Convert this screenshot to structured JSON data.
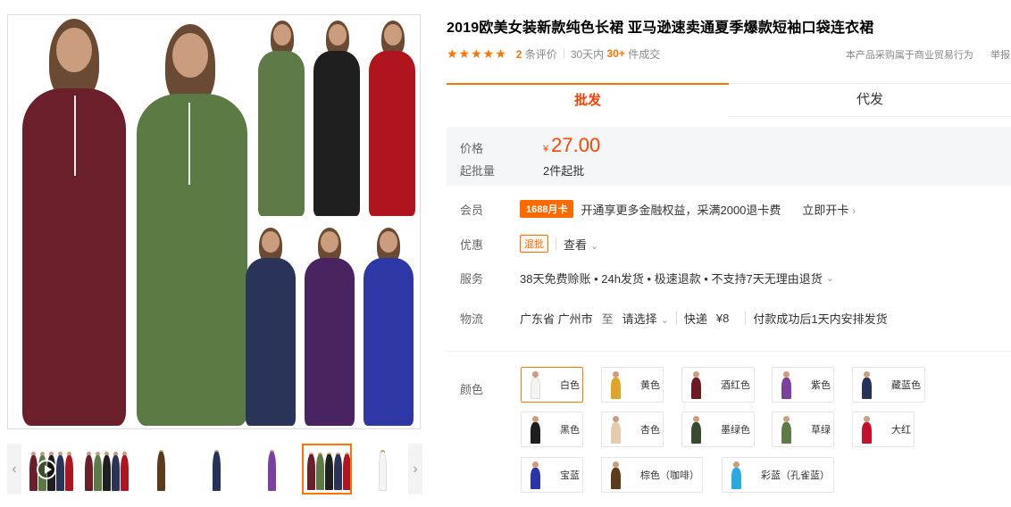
{
  "title": "2019欧美女装新款纯色长裙 亚马逊速卖通夏季爆款短袖口袋连衣裙",
  "rating": {
    "stars": "★★★★★",
    "review_count": "2",
    "review_label": "条评价",
    "days_label": "30天内",
    "sold_count": "30+",
    "sold_label": "件成交",
    "trade_note": "本产品采购属于商业贸易行为",
    "report": "举报"
  },
  "tabs": [
    {
      "label": "批发",
      "active": true
    },
    {
      "label": "代发",
      "active": false
    }
  ],
  "price": {
    "label": "价格",
    "currency": "¥",
    "value": "27.00",
    "moq_label": "起批量",
    "moq_value": "2件起批"
  },
  "member": {
    "label": "会员",
    "badge": "1688月卡",
    "text": "开通享更多金融权益，采满2000退卡费",
    "link": "立即开卡"
  },
  "promo": {
    "label": "优惠",
    "badge": "混批",
    "link": "查看"
  },
  "service": {
    "label": "服务",
    "text": "38天免费赊账 • 24h发货 • 极速退款 • 不支持7天无理由退货"
  },
  "logistics": {
    "label": "物流",
    "origin": "广东省 广州市",
    "to": "至",
    "destination": "请选择",
    "express": "快递",
    "fee": "¥8",
    "ship_note": "付款成功后1天内安排发货"
  },
  "colors": {
    "label": "颜色",
    "options": [
      {
        "name": "白色",
        "color": "#f4f4f4",
        "selected": true
      },
      {
        "name": "黄色",
        "color": "#e0a428"
      },
      {
        "name": "酒红色",
        "color": "#6e1a24"
      },
      {
        "name": "紫色",
        "color": "#7b3fa0"
      },
      {
        "name": "藏蓝色",
        "color": "#27325a"
      },
      {
        "name": "黑色",
        "color": "#1e1e1e"
      },
      {
        "name": "杏色",
        "color": "#e7cbb0"
      },
      {
        "name": "墨绿色",
        "color": "#384a30"
      },
      {
        "name": "草绿",
        "color": "#5d7a47"
      },
      {
        "name": "大红",
        "color": "#c8102e"
      },
      {
        "name": "宝蓝",
        "color": "#2a35a8"
      },
      {
        "name": "棕色（咖啡）",
        "color": "#5a3b1c"
      },
      {
        "name": "彩蓝（孔雀蓝）",
        "color": "#28a9e0"
      }
    ]
  },
  "gallery": {
    "main_dresses": [
      "#6a1f2b",
      "#5b7a44",
      "#5d7a47",
      "#1f1f1f",
      "#b0141f",
      "#2a3358",
      "#4a2460",
      "#2d37a6"
    ],
    "thumbnails": [
      "#6a1f2b",
      "#5b7a44",
      "#5a3b1c",
      "#27325a",
      "#7b3fa0",
      "#5b7a44",
      "#f4f4f4"
    ],
    "active_thumbnail": 5
  }
}
